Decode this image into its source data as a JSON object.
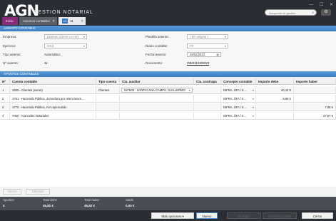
{
  "app": {
    "logo": "AGN",
    "brand": "GESTIÓN NOTARIAL",
    "search_placeholder": "Búsqueda de gestión",
    "window_controls": [
      "—",
      "☐",
      "✕"
    ]
  },
  "tabs": [
    {
      "label": "Inicio"
    },
    {
      "label": "Asientos contables"
    },
    {
      "label": "11",
      "icon": "AS"
    }
  ],
  "agent_section": {
    "title": "ASIENTO CONTABLE"
  },
  "form": {
    "empresa_label": "Empresa:",
    "empresa_value": "Esteban Gómez Le Hoz",
    "ejercicio_label": "Ejercicio:",
    "ejercicio_value": "2013",
    "tipo_label": "Tipo asiento:",
    "tipo_value": "Automático",
    "numero_label": "Nº asiento:",
    "numero_value": "11",
    "plantilla_label": "Plantilla asiento:",
    "plantilla_value": "( Sin asignar )",
    "diario_label": "Diario contable:",
    "diario_value": "FR",
    "fecha_label": "Fecha asiento:",
    "fecha_value": "28/02/2013",
    "documento_label": "Documento:",
    "documento_value": "OB/01133/0023"
  },
  "apuntes_section": {
    "title": "APUNTES CONTABLES"
  },
  "table": {
    "headers": [
      "Nº",
      "Cuenta contable",
      "Tipo cuenta",
      "Cta. auxiliar",
      "Cta. contrapa",
      "Concepto contable",
      "Importe debe",
      "Importe haber"
    ],
    "rows": [
      {
        "n": "1",
        "cuenta": "4300 - Clientes (euros)",
        "tipo": "Clientes",
        "auxiliar": "047509 - SANTACANA CAMPS, GUILLERMO",
        "contrapa": "",
        "concepto": "N/FRA. SFA / 0...",
        "debe": "40,14 €",
        "haber": ""
      },
      {
        "n": "2",
        "cuenta": "4751 - Hacienda Pública, acreedora por retenciones...",
        "tipo": "",
        "auxiliar": "",
        "contrapa": "",
        "concepto": "N/FRA. SFA / 0...",
        "debe": "5,68 €",
        "haber": ""
      },
      {
        "n": "3",
        "cuenta": "4770 - Hacienda Pública, IVA repercutido",
        "tipo": "",
        "auxiliar": "",
        "contrapa": "",
        "concepto": "N/FRA. SFA / 0...",
        "debe": "",
        "haber": "7,95 €"
      },
      {
        "n": "4",
        "cuenta": "7050 - Aranceles Notariales",
        "tipo": "",
        "auxiliar": "",
        "contrapa": "",
        "concepto": "N/FRA. SFA / 0...",
        "debe": "",
        "haber": "37,87 €"
      }
    ]
  },
  "row_actions": {
    "nuevo": "Nuevo",
    "eliminar": "Eliminar"
  },
  "totals": {
    "apuntes_label": "Apuntes",
    "apuntes_value": "4",
    "debe_label": "Total debe",
    "debe_value": "45,82 €",
    "haber_label": "Total haber",
    "haber_value": "45,82 €",
    "saldo_label": "Saldo",
    "saldo_value": "0,00 €"
  },
  "footer": {
    "mas_opciones": "Más opciones",
    "nuevo": "Nuevo",
    "guardar": "Guardar",
    "guardar_cerrar": "Guardar y cerrar",
    "cerrar": "Cerrar"
  },
  "colors": {
    "accent": "#3a7cc0",
    "inicio_tab": "#8a2a7a",
    "titlebar": "#2a2d33"
  }
}
